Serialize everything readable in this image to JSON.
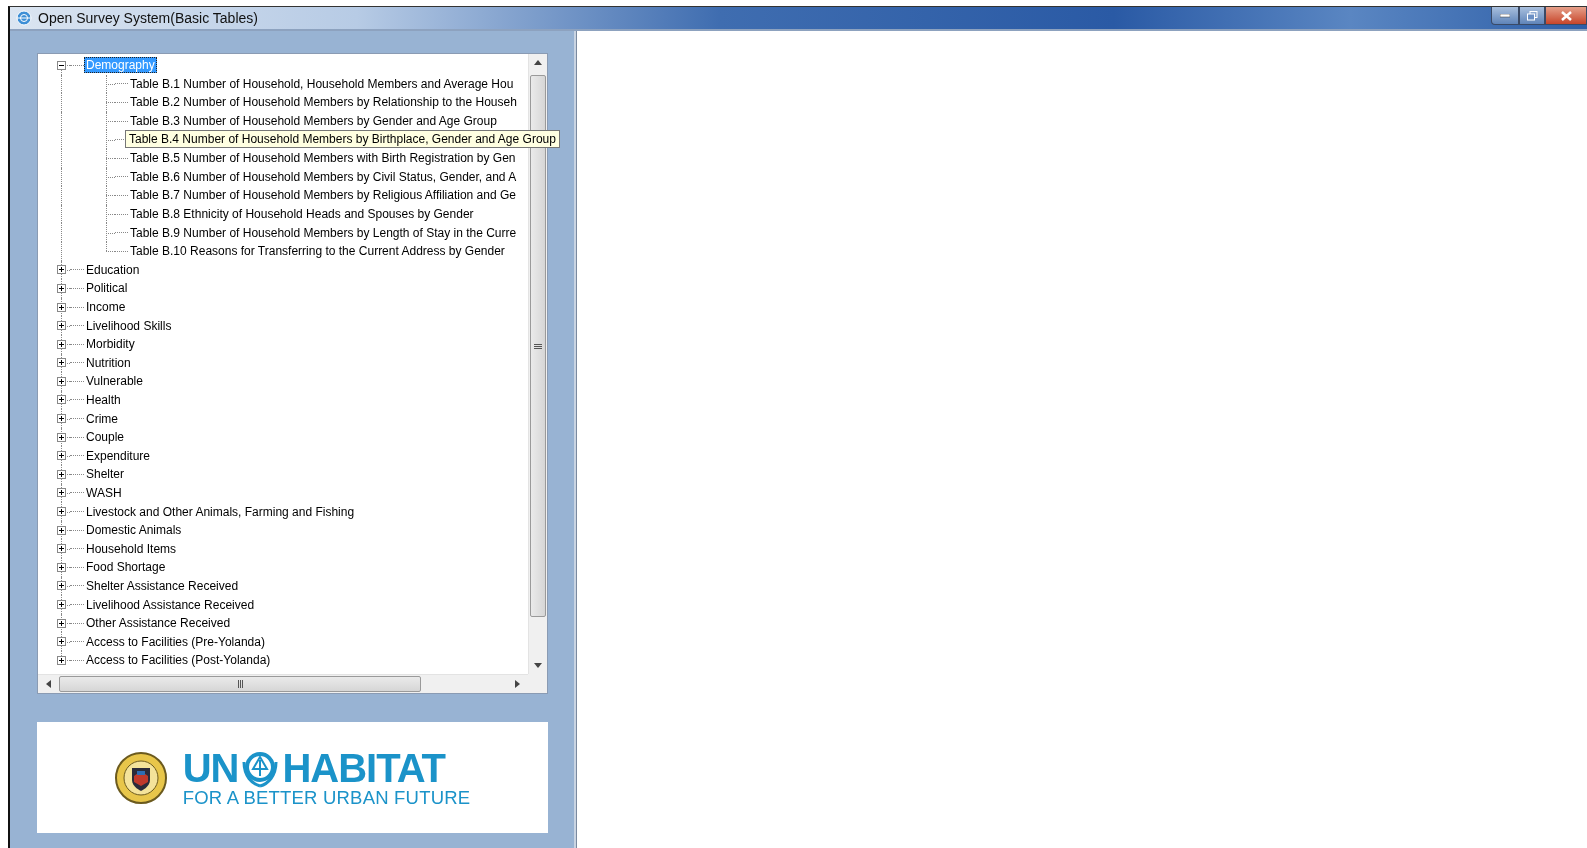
{
  "window": {
    "title": "Open Survey System(Basic Tables)"
  },
  "tree": {
    "items": [
      {
        "label": "Demography",
        "expanded": true,
        "selected": true,
        "children": [
          {
            "label": "Table B.1 Number of Household, Household Members and Average Hou",
            "hovered": false
          },
          {
            "label": "Table B.2 Number of Household Members by Relationship to the Househ",
            "hovered": false
          },
          {
            "label": "Table B.3 Number of Household Members by Gender and Age Group",
            "hovered": false
          },
          {
            "label": "Table B.4 Number of Household Members by Birthplace, Gender and Age Group",
            "hovered": true
          },
          {
            "label": "Table B.5 Number of Household Members with Birth Registration by Gen",
            "hovered": false
          },
          {
            "label": "Table B.6 Number of Household Members by Civil Status, Gender, and A",
            "hovered": false
          },
          {
            "label": "Table B.7 Number of Household Members by Religious Affiliation and Ge",
            "hovered": false
          },
          {
            "label": "Table B.8 Ethnicity of Household Heads and Spouses by Gender",
            "hovered": false
          },
          {
            "label": "Table B.9 Number of Household Members by Length of Stay in the Curre",
            "hovered": false
          },
          {
            "label": "Table B.10 Reasons for Transferring to the Current Address by Gender",
            "hovered": false
          }
        ]
      },
      {
        "label": "Education",
        "expanded": false,
        "selected": false
      },
      {
        "label": "Political",
        "expanded": false,
        "selected": false
      },
      {
        "label": "Income",
        "expanded": false,
        "selected": false
      },
      {
        "label": "Livelihood Skills",
        "expanded": false,
        "selected": false
      },
      {
        "label": "Morbidity",
        "expanded": false,
        "selected": false
      },
      {
        "label": "Nutrition",
        "expanded": false,
        "selected": false
      },
      {
        "label": "Vulnerable",
        "expanded": false,
        "selected": false
      },
      {
        "label": "Health",
        "expanded": false,
        "selected": false
      },
      {
        "label": "Crime",
        "expanded": false,
        "selected": false
      },
      {
        "label": "Couple",
        "expanded": false,
        "selected": false
      },
      {
        "label": "Expenditure",
        "expanded": false,
        "selected": false
      },
      {
        "label": "Shelter",
        "expanded": false,
        "selected": false
      },
      {
        "label": "WASH",
        "expanded": false,
        "selected": false
      },
      {
        "label": "Livestock and Other Animals, Farming and Fishing",
        "expanded": false,
        "selected": false
      },
      {
        "label": "Domestic Animals",
        "expanded": false,
        "selected": false
      },
      {
        "label": "Household Items",
        "expanded": false,
        "selected": false
      },
      {
        "label": "Food Shortage",
        "expanded": false,
        "selected": false
      },
      {
        "label": "Shelter Assistance Received",
        "expanded": false,
        "selected": false
      },
      {
        "label": "Livelihood Assistance Received",
        "expanded": false,
        "selected": false
      },
      {
        "label": "Other Assistance Received",
        "expanded": false,
        "selected": false
      },
      {
        "label": "Access to Facilities (Pre-Yolanda)",
        "expanded": false,
        "selected": false
      },
      {
        "label": "Access to Facilities (Post-Yolanda)",
        "expanded": false,
        "selected": false
      }
    ]
  },
  "logo": {
    "brand_left": "UN",
    "brand_right": "HABITAT",
    "tagline": "FOR A BETTER URBAN FUTURE"
  }
}
